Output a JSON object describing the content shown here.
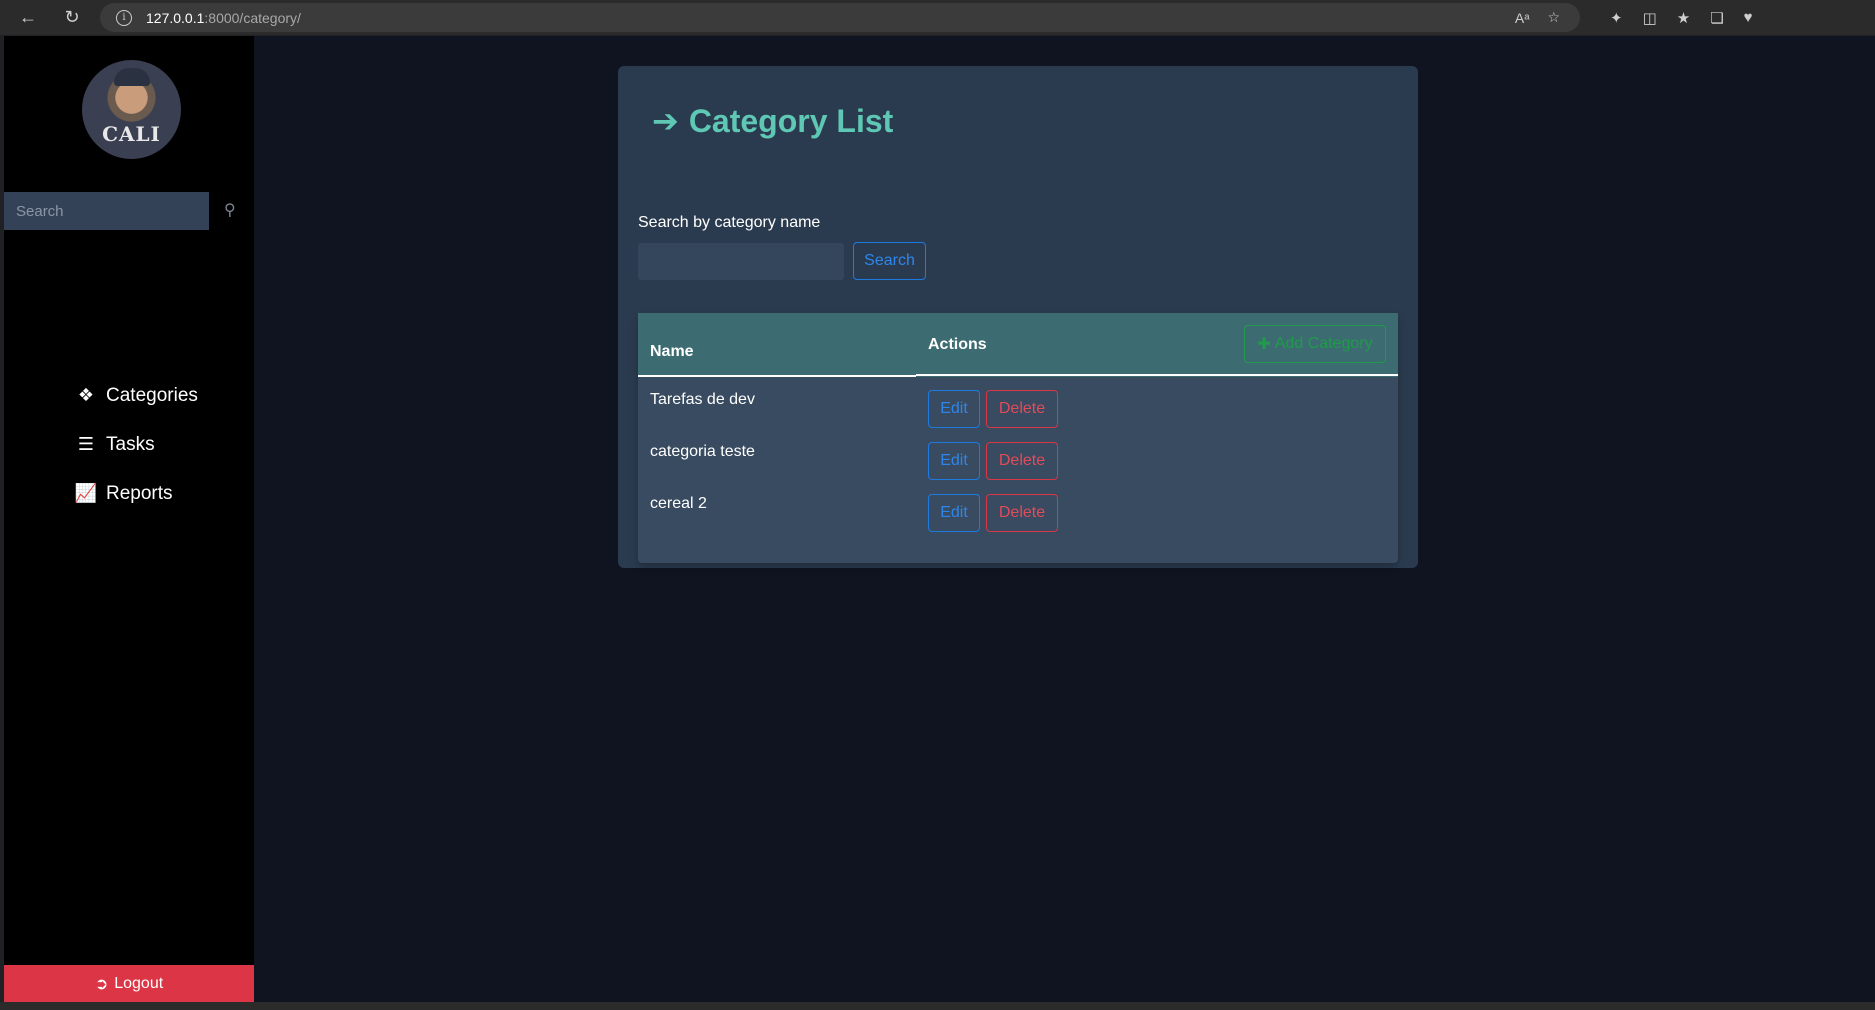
{
  "browser": {
    "url_host": "127.0.0.1",
    "url_path": ":8000/category/",
    "info_icon": "i"
  },
  "sidebar": {
    "search_placeholder": "Search",
    "avatar_text": "CALI",
    "items": [
      {
        "label": "Categories",
        "icon": "tags-icon"
      },
      {
        "label": "Tasks",
        "icon": "list-check-icon"
      },
      {
        "label": "Reports",
        "icon": "chart-line-icon"
      }
    ],
    "logout_label": "Logout"
  },
  "main": {
    "title": "Category List",
    "search_label": "Search by category name",
    "search_button": "Search",
    "add_button": "Add Category",
    "table": {
      "columns": [
        "Name",
        "Actions"
      ],
      "rows": [
        {
          "name": "Tarefas de dev",
          "edit": "Edit",
          "delete": "Delete"
        },
        {
          "name": "categoria teste",
          "edit": "Edit",
          "delete": "Delete"
        },
        {
          "name": "cereal 2",
          "edit": "Edit",
          "delete": "Delete"
        }
      ]
    }
  },
  "colors": {
    "accent": "#5fc8b5",
    "primary": "#1f7ae0",
    "danger": "#dc3545",
    "success": "#1f9b4a"
  }
}
